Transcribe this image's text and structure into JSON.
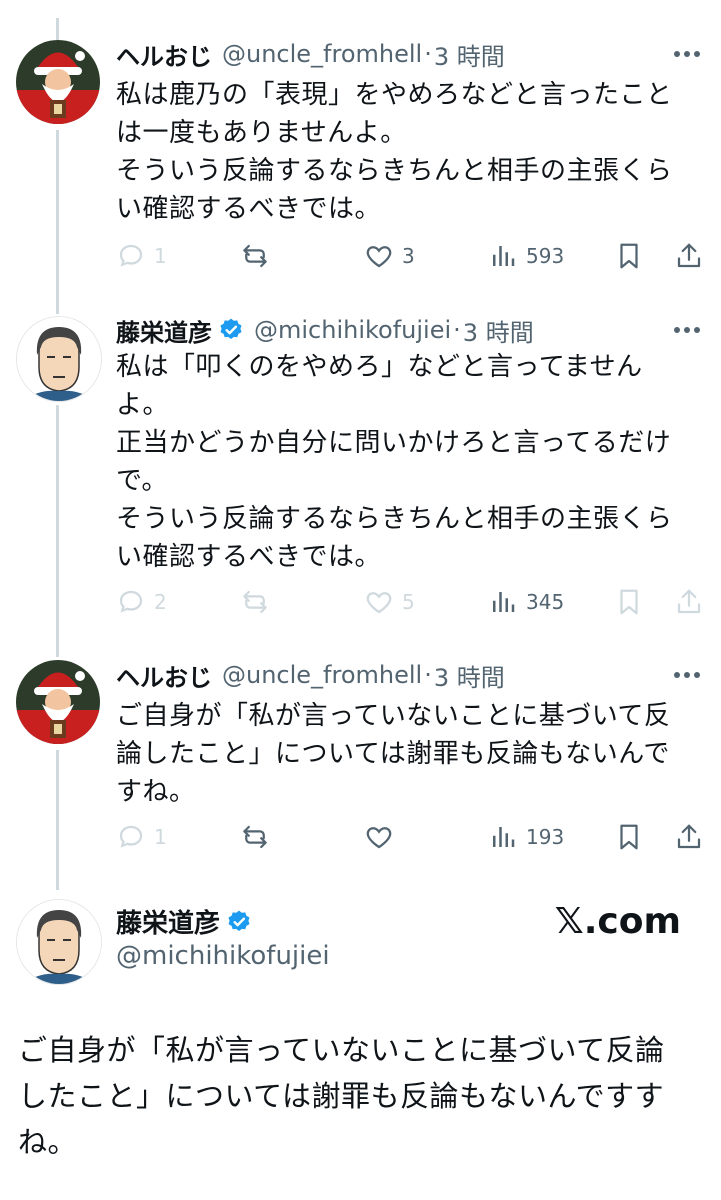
{
  "colors": {
    "text": "#0f1419",
    "secondary": "#536471",
    "dim": "#cfd9de",
    "verified": "#1d9bf0"
  },
  "tweets": [
    {
      "name": "ヘルおじ",
      "handle": "@uncle_fromhell",
      "sep": "·",
      "time": "3 時間",
      "text": "私は鹿乃の「表現」をやめろなどと言ったこと\nは一度もありませんよ。\nそういう反論するならきちんと相手の主張くら\nい確認するべきでは。",
      "replies": "1",
      "likes": "3",
      "views": "593"
    },
    {
      "name": "藤栄道彦",
      "handle": "@michihikofujiei",
      "sep": "·",
      "time": "3 時間",
      "text": "私は「叩くのをやめろ」などと言ってません\nよ。\n正当かどうか自分に問いかけろと言ってるだけ\nで。\nそういう反論するならきちんと相手の主張くら\nい確認するべきでは。",
      "replies": "2",
      "likes": "5",
      "views": "345"
    },
    {
      "name": "ヘルおじ",
      "handle": "@uncle_fromhell",
      "sep": "·",
      "time": "3 時間",
      "text": "ご自身が「私が言っていないことに基づいて反\n論したこと」については謝罪も反論もないんで\nすね。",
      "replies": "1",
      "likes": "",
      "views": "193"
    }
  ],
  "card": {
    "name": "藤栄道彦",
    "handle": "@michihikofujiei",
    "logo": "𝕏.com",
    "text": "ご自身が「私が言っていないことに基づいて反論\nしたこと」については謝罪も反論もないんですす\nね。"
  }
}
